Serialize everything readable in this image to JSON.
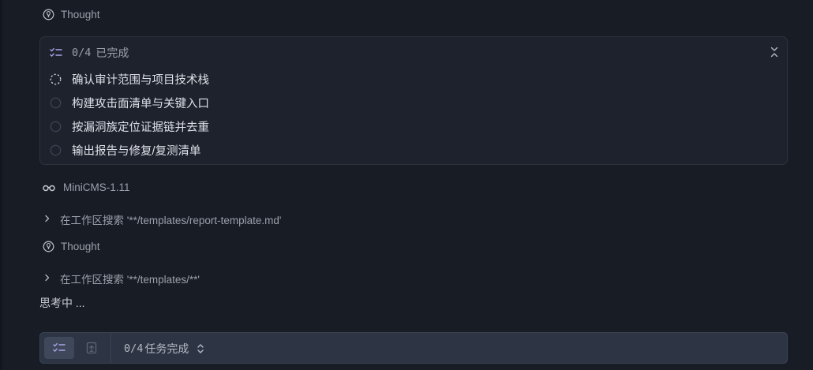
{
  "thought_1": {
    "label": "Thought",
    "icon": "lightbulb-icon"
  },
  "todo": {
    "count": "0/4",
    "done_label": "已完成",
    "icon": "checklist-icon",
    "items": [
      {
        "label": "确认审计范围与项目技术栈",
        "status": "in-progress"
      },
      {
        "label": "构建攻击面清单与关键入口",
        "status": "pending"
      },
      {
        "label": "按漏洞族定位证据链并去重",
        "status": "pending"
      },
      {
        "label": "输出报告与修复/复测清单",
        "status": "pending"
      }
    ]
  },
  "workspace": {
    "label": "MiniCMS-1.11",
    "icon": "glasses-icon"
  },
  "search_1": {
    "label": "在工作区搜索 '**/templates/report-template.md'"
  },
  "thought_2": {
    "label": "Thought",
    "icon": "lightbulb-icon"
  },
  "search_2": {
    "label": "在工作区搜索 '**/templates/**'"
  },
  "thinking": "思考中 ...",
  "bottom_bar": {
    "count": "0/4",
    "status_label": "任务完成"
  },
  "colors": {
    "background": "#181c25",
    "card": "#1d222d",
    "accent": "#a9a4e8",
    "bottom_bar": "#2d3443"
  }
}
